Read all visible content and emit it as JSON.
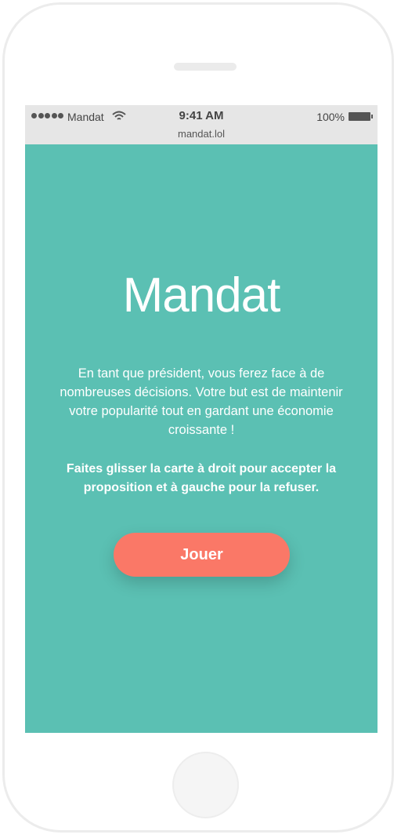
{
  "status_bar": {
    "carrier": "Mandat",
    "time": "9:41 AM",
    "url": "mandat.lol",
    "battery": "100%",
    "signal_icon": "signal-dots-icon",
    "wifi_icon": "wifi-icon",
    "battery_icon": "battery-icon"
  },
  "main": {
    "logo": "Mandat",
    "intro": "En tant que président, vous ferez face à de nombreuses décisions. Votre but est de maintenir votre popularité tout en gardant une économie croissante !",
    "instructions": "Faites glisser la carte à droit pour accepter la proposition et à gauche pour la refuser.",
    "play_label": "Jouer"
  },
  "colors": {
    "background": "#5bc0b3",
    "button": "#fa7867",
    "status_bar": "#e6e6e6"
  }
}
